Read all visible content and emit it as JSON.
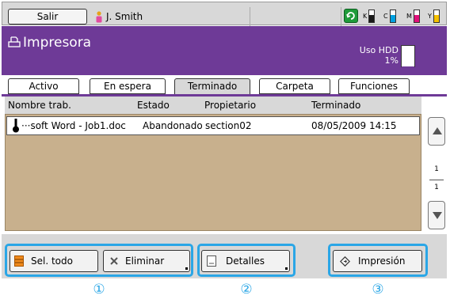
{
  "topbar": {
    "logout_label": "Salir",
    "user_name": "J. Smith",
    "toner": [
      {
        "label": "K",
        "color": "#1a1a1a",
        "level": 0.6
      },
      {
        "label": "C",
        "color": "#00a0e0",
        "level": 0.6
      },
      {
        "label": "M",
        "color": "#e0107a",
        "level": 0.6
      },
      {
        "label": "Y",
        "color": "#f5c000",
        "level": 0.6
      }
    ],
    "eco_icon": "eco-refresh-icon"
  },
  "header": {
    "title": "Impresora",
    "hdd_label": "Uso HDD",
    "hdd_value": "1%",
    "hdd_fill_fraction": 0.01
  },
  "tabs": [
    {
      "label": "Activo",
      "active": false
    },
    {
      "label": "En espera",
      "active": false
    },
    {
      "label": "Terminado",
      "active": true
    },
    {
      "label": "Carpeta",
      "active": false
    },
    {
      "label": "Funciones",
      "active": false
    }
  ],
  "list": {
    "columns": [
      "Nombre trab.",
      "Estado",
      "Propietario",
      "Terminado"
    ],
    "rows": [
      {
        "name": "···soft Word - Job1.doc",
        "status": "Abandonado",
        "owner": "section02",
        "finished": "08/05/2009 14:15"
      }
    ]
  },
  "pager": {
    "current": "1",
    "total": "1"
  },
  "bottom": {
    "select_all": "Sel. todo",
    "delete": "Eliminar",
    "details": "Detalles",
    "print": "Impresión"
  },
  "markers": [
    "①",
    "②",
    "③"
  ],
  "colors": {
    "accent": "#6e3a97",
    "highlight": "#2aa6e6",
    "list_bg": "#c8b08d"
  }
}
